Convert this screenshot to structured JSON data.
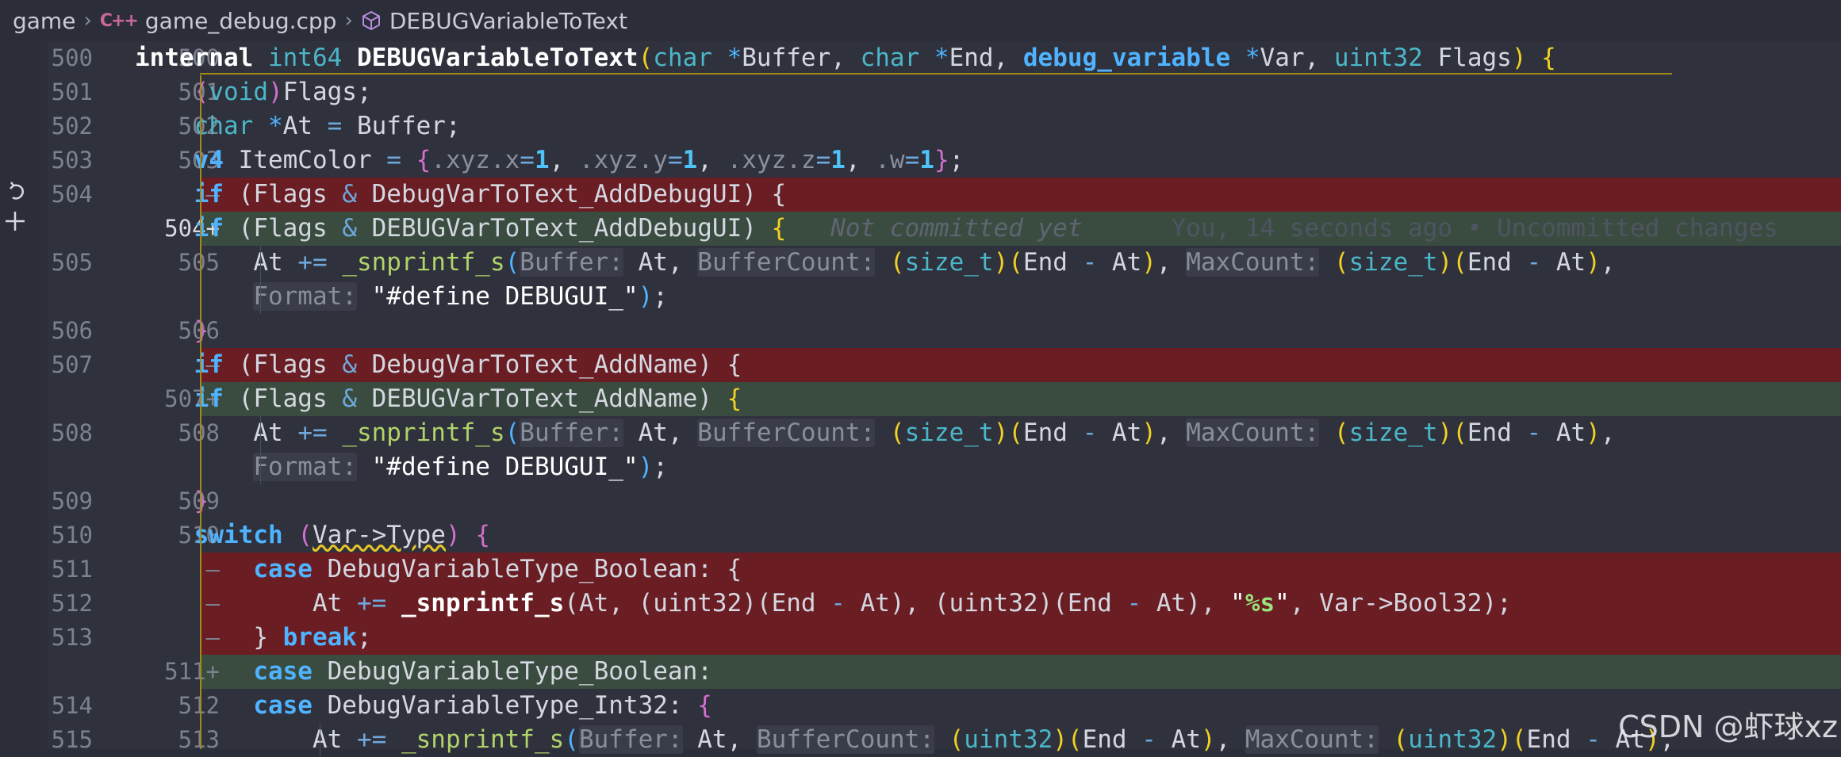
{
  "breadcrumb": {
    "folder": "game",
    "lang_icon": "C++",
    "file": "game_debug.cpp",
    "symbol_icon": "cube-icon",
    "symbol": "DEBUGVariableToText"
  },
  "gutter_icons": [
    "revert-icon",
    "add-icon"
  ],
  "colors": {
    "background": "#2f313c",
    "deleted_line": "#6a1d23",
    "added_line": "#3a4c3f",
    "keyword": "#4fb3ff",
    "type": "#4bb6c8",
    "string": "#ffffff",
    "number": "#4fc3f7",
    "guide": "#a68a18"
  },
  "watermark": "CSDN @虾球xz",
  "lines": [
    {
      "old": "500",
      "new": "500",
      "kind": "ctx",
      "s": [
        {
          "t": "internal ",
          "c": "w",
          "b": 1
        },
        {
          "t": "int64 ",
          "c": "type"
        },
        {
          "t": "DEBUGVariableToText",
          "c": "w",
          "b": 1
        },
        {
          "t": "(",
          "c": "p1"
        },
        {
          "t": "char ",
          "c": "type"
        },
        {
          "t": "*",
          "c": "kw"
        },
        {
          "t": "Buffer, ",
          "c": "t"
        },
        {
          "t": "char ",
          "c": "type"
        },
        {
          "t": "*",
          "c": "kw"
        },
        {
          "t": "End, ",
          "c": "t"
        },
        {
          "t": "debug_variable ",
          "c": "kw",
          "b": 1
        },
        {
          "t": "*",
          "c": "kw"
        },
        {
          "t": "Var, ",
          "c": "t"
        },
        {
          "t": "uint32 ",
          "c": "type"
        },
        {
          "t": "Flags",
          "c": "t"
        },
        {
          "t": ") ",
          "c": "p1"
        },
        {
          "t": "{",
          "c": "p1"
        }
      ]
    },
    {
      "old": "501",
      "new": "501",
      "kind": "ctx",
      "s": [
        {
          "t": "    "
        },
        {
          "t": "(",
          "c": "p2"
        },
        {
          "t": "void",
          "c": "type"
        },
        {
          "t": ")",
          "c": "p2"
        },
        {
          "t": "Flags;",
          "c": "t"
        }
      ]
    },
    {
      "old": "502",
      "new": "502",
      "kind": "ctx",
      "s": [
        {
          "t": "    "
        },
        {
          "t": "char",
          "c": "type"
        },
        {
          "t": " ",
          "c": "t"
        },
        {
          "t": "*",
          "c": "kw"
        },
        {
          "t": "At ",
          "c": "t"
        },
        {
          "t": "= ",
          "c": "op"
        },
        {
          "t": "Buffer;",
          "c": "t"
        }
      ]
    },
    {
      "old": "503",
      "new": "503",
      "kind": "ctx",
      "s": [
        {
          "t": "    "
        },
        {
          "t": "v4 ",
          "c": "kw",
          "b": 1
        },
        {
          "t": "ItemColor ",
          "c": "t"
        },
        {
          "t": "= ",
          "c": "op"
        },
        {
          "t": "{",
          "c": "p2"
        },
        {
          "t": ".xyz.x",
          "c": "dim"
        },
        {
          "t": "=",
          "c": "op"
        },
        {
          "t": "1",
          "c": "num",
          "b": 1
        },
        {
          "t": ", ",
          "c": "t"
        },
        {
          "t": ".xyz.y",
          "c": "dim"
        },
        {
          "t": "=",
          "c": "op"
        },
        {
          "t": "1",
          "c": "num",
          "b": 1
        },
        {
          "t": ", ",
          "c": "t"
        },
        {
          "t": ".xyz.z",
          "c": "dim"
        },
        {
          "t": "=",
          "c": "op"
        },
        {
          "t": "1",
          "c": "num",
          "b": 1
        },
        {
          "t": ", ",
          "c": "t"
        },
        {
          "t": ".w",
          "c": "dim"
        },
        {
          "t": "=",
          "c": "op"
        },
        {
          "t": "1",
          "c": "num",
          "b": 1
        },
        {
          "t": "}",
          "c": "p2"
        },
        {
          "t": ";",
          "c": "t"
        }
      ]
    },
    {
      "old": "504",
      "new": "—",
      "kind": "del",
      "s": [
        {
          "t": "    "
        },
        {
          "t": "if ",
          "c": "kw",
          "b": 1
        },
        {
          "t": "(Flags ",
          "c": "t"
        },
        {
          "t": "& ",
          "c": "op"
        },
        {
          "t": "DebugVarToText_AddDebugUI) {",
          "c": "t"
        }
      ]
    },
    {
      "old": "",
      "new": "504+",
      "kind": "add",
      "cur": 1,
      "s": [
        {
          "t": "    "
        },
        {
          "t": "if ",
          "c": "kw",
          "b": 1
        },
        {
          "t": "(Flags ",
          "c": "t"
        },
        {
          "t": "& ",
          "c": "op"
        },
        {
          "t": "DEBUGVarToText_AddDebugUI) ",
          "c": "t"
        },
        {
          "t": "{",
          "c": "p1"
        }
      ],
      "blame": "Not committed yet",
      "blame_info": "You, 14 seconds ago • Uncommitted changes"
    },
    {
      "old": "505",
      "new": "505",
      "kind": "ctx",
      "s": [
        {
          "t": "        "
        },
        {
          "t": "At ",
          "c": "t"
        },
        {
          "t": "+= ",
          "c": "op"
        },
        {
          "t": "_snprintf_s",
          "c": "fn"
        },
        {
          "t": "(",
          "c": "p3"
        },
        {
          "t": "Buffer:",
          "c": "hint"
        },
        {
          "t": " At, ",
          "c": "t"
        },
        {
          "t": "BufferCount:",
          "c": "hint"
        },
        {
          "t": " ",
          "c": "t"
        },
        {
          "t": "(",
          "c": "p1"
        },
        {
          "t": "size_t",
          "c": "type"
        },
        {
          "t": ")",
          "c": "p1"
        },
        {
          "t": "(",
          "c": "p1"
        },
        {
          "t": "End ",
          "c": "t"
        },
        {
          "t": "- ",
          "c": "op"
        },
        {
          "t": "At",
          "c": "t"
        },
        {
          "t": ")",
          "c": "p1"
        },
        {
          "t": ", ",
          "c": "t"
        },
        {
          "t": "MaxCount:",
          "c": "hint"
        },
        {
          "t": " ",
          "c": "t"
        },
        {
          "t": "(",
          "c": "p1"
        },
        {
          "t": "size_t",
          "c": "type"
        },
        {
          "t": ")",
          "c": "p1"
        },
        {
          "t": "(",
          "c": "p1"
        },
        {
          "t": "End ",
          "c": "t"
        },
        {
          "t": "- ",
          "c": "op"
        },
        {
          "t": "At",
          "c": "t"
        },
        {
          "t": ")",
          "c": "p1"
        },
        {
          "t": ",",
          "c": "t"
        }
      ]
    },
    {
      "old": "",
      "new": "",
      "kind": "wrap",
      "s": [
        {
          "t": "        "
        },
        {
          "t": "Format:",
          "c": "hint"
        },
        {
          "t": " ",
          "c": "t"
        },
        {
          "t": "\"#define DEBUGUI_\"",
          "c": "str"
        },
        {
          "t": ")",
          "c": "p3"
        },
        {
          "t": ";",
          "c": "t"
        }
      ]
    },
    {
      "old": "506",
      "new": "506",
      "kind": "ctx",
      "s": [
        {
          "t": "    "
        },
        {
          "t": "}",
          "c": "p2"
        }
      ]
    },
    {
      "old": "507",
      "new": "—",
      "kind": "del",
      "s": [
        {
          "t": "    "
        },
        {
          "t": "if ",
          "c": "kw",
          "b": 1
        },
        {
          "t": "(Flags ",
          "c": "t"
        },
        {
          "t": "& ",
          "c": "op"
        },
        {
          "t": "DebugVarToText_AddName) {",
          "c": "t"
        }
      ]
    },
    {
      "old": "",
      "new": "507+",
      "kind": "add",
      "s": [
        {
          "t": "    "
        },
        {
          "t": "if ",
          "c": "kw",
          "b": 1
        },
        {
          "t": "(Flags ",
          "c": "t"
        },
        {
          "t": "& ",
          "c": "op"
        },
        {
          "t": "DEBUGVarToText_AddName) ",
          "c": "t"
        },
        {
          "t": "{",
          "c": "p1"
        }
      ]
    },
    {
      "old": "508",
      "new": "508",
      "kind": "ctx",
      "s": [
        {
          "t": "        "
        },
        {
          "t": "At ",
          "c": "t"
        },
        {
          "t": "+= ",
          "c": "op"
        },
        {
          "t": "_snprintf_s",
          "c": "fn"
        },
        {
          "t": "(",
          "c": "p3"
        },
        {
          "t": "Buffer:",
          "c": "hint"
        },
        {
          "t": " At, ",
          "c": "t"
        },
        {
          "t": "BufferCount:",
          "c": "hint"
        },
        {
          "t": " ",
          "c": "t"
        },
        {
          "t": "(",
          "c": "p1"
        },
        {
          "t": "size_t",
          "c": "type"
        },
        {
          "t": ")",
          "c": "p1"
        },
        {
          "t": "(",
          "c": "p1"
        },
        {
          "t": "End ",
          "c": "t"
        },
        {
          "t": "- ",
          "c": "op"
        },
        {
          "t": "At",
          "c": "t"
        },
        {
          "t": ")",
          "c": "p1"
        },
        {
          "t": ", ",
          "c": "t"
        },
        {
          "t": "MaxCount:",
          "c": "hint"
        },
        {
          "t": " ",
          "c": "t"
        },
        {
          "t": "(",
          "c": "p1"
        },
        {
          "t": "size_t",
          "c": "type"
        },
        {
          "t": ")",
          "c": "p1"
        },
        {
          "t": "(",
          "c": "p1"
        },
        {
          "t": "End ",
          "c": "t"
        },
        {
          "t": "- ",
          "c": "op"
        },
        {
          "t": "At",
          "c": "t"
        },
        {
          "t": ")",
          "c": "p1"
        },
        {
          "t": ",",
          "c": "t"
        }
      ]
    },
    {
      "old": "",
      "new": "",
      "kind": "wrap",
      "s": [
        {
          "t": "        "
        },
        {
          "t": "Format:",
          "c": "hint"
        },
        {
          "t": " ",
          "c": "t"
        },
        {
          "t": "\"#define DEBUGUI_\"",
          "c": "str"
        },
        {
          "t": ")",
          "c": "p3"
        },
        {
          "t": ";",
          "c": "t"
        }
      ]
    },
    {
      "old": "509",
      "new": "509",
      "kind": "ctx",
      "s": [
        {
          "t": "    "
        },
        {
          "t": "}",
          "c": "p2"
        }
      ]
    },
    {
      "old": "510",
      "new": "510",
      "kind": "ctx",
      "s": [
        {
          "t": "    "
        },
        {
          "t": "switch ",
          "c": "kw",
          "b": 1
        },
        {
          "t": "(",
          "c": "p2"
        },
        {
          "t": "Var->Type",
          "c": "t",
          "u": 1
        },
        {
          "t": ")",
          "c": "p2"
        },
        {
          "t": " ",
          "c": "t"
        },
        {
          "t": "{",
          "c": "p2"
        }
      ]
    },
    {
      "old": "511",
      "new": "—",
      "kind": "del",
      "s": [
        {
          "t": "        "
        },
        {
          "t": "case ",
          "c": "kw",
          "b": 1
        },
        {
          "t": "DebugVariableType_Boolean: {",
          "c": "t"
        }
      ]
    },
    {
      "old": "512",
      "new": "—",
      "kind": "del",
      "s": [
        {
          "t": "            "
        },
        {
          "t": "At ",
          "c": "t"
        },
        {
          "t": "+= ",
          "c": "op"
        },
        {
          "t": "_snprintf_s",
          "c": "w",
          "b": 1
        },
        {
          "t": "(At, (uint32)(End ",
          "c": "t"
        },
        {
          "t": "- ",
          "c": "op"
        },
        {
          "t": "At), (uint32)(End ",
          "c": "t"
        },
        {
          "t": "- ",
          "c": "op"
        },
        {
          "t": "At), ",
          "c": "t"
        },
        {
          "t": "\"",
          "c": "str"
        },
        {
          "t": "%s",
          "c": "fmt",
          "b": 1
        },
        {
          "t": "\"",
          "c": "str"
        },
        {
          "t": ", Var->Bool32);",
          "c": "t"
        }
      ]
    },
    {
      "old": "513",
      "new": "—",
      "kind": "del",
      "s": [
        {
          "t": "        "
        },
        {
          "t": "} ",
          "c": "t"
        },
        {
          "t": "break",
          "c": "kw",
          "b": 1
        },
        {
          "t": ";",
          "c": "t"
        }
      ]
    },
    {
      "old": "",
      "new": "511+",
      "kind": "add",
      "s": [
        {
          "t": "        "
        },
        {
          "t": "case ",
          "c": "kw",
          "b": 1
        },
        {
          "t": "DebugVariableType_Boolean:",
          "c": "t"
        }
      ]
    },
    {
      "old": "514",
      "new": "512",
      "kind": "ctx",
      "s": [
        {
          "t": "        "
        },
        {
          "t": "case ",
          "c": "kw",
          "b": 1
        },
        {
          "t": "DebugVariableType_Int32: ",
          "c": "t"
        },
        {
          "t": "{",
          "c": "p2"
        }
      ]
    },
    {
      "old": "515",
      "new": "513",
      "kind": "ctx",
      "s": [
        {
          "t": "            "
        },
        {
          "t": "At ",
          "c": "t"
        },
        {
          "t": "+= ",
          "c": "op"
        },
        {
          "t": "_snprintf_s",
          "c": "fn"
        },
        {
          "t": "(",
          "c": "p3"
        },
        {
          "t": "Buffer:",
          "c": "hint"
        },
        {
          "t": " At, ",
          "c": "t"
        },
        {
          "t": "BufferCount:",
          "c": "hint"
        },
        {
          "t": " ",
          "c": "t"
        },
        {
          "t": "(",
          "c": "p1"
        },
        {
          "t": "uint32",
          "c": "type"
        },
        {
          "t": ")",
          "c": "p1"
        },
        {
          "t": "(",
          "c": "p1"
        },
        {
          "t": "End ",
          "c": "t"
        },
        {
          "t": "- ",
          "c": "op"
        },
        {
          "t": "At",
          "c": "t"
        },
        {
          "t": ")",
          "c": "p1"
        },
        {
          "t": ", ",
          "c": "t"
        },
        {
          "t": "MaxCount:",
          "c": "hint"
        },
        {
          "t": " ",
          "c": "t"
        },
        {
          "t": "(",
          "c": "p1"
        },
        {
          "t": "uint32",
          "c": "type"
        },
        {
          "t": ")",
          "c": "p1"
        },
        {
          "t": "(",
          "c": "p1"
        },
        {
          "t": "End ",
          "c": "t"
        },
        {
          "t": "- ",
          "c": "op"
        },
        {
          "t": "At",
          "c": "t"
        },
        {
          "t": ")",
          "c": "p1"
        },
        {
          "t": ",",
          "c": "t"
        }
      ]
    }
  ]
}
